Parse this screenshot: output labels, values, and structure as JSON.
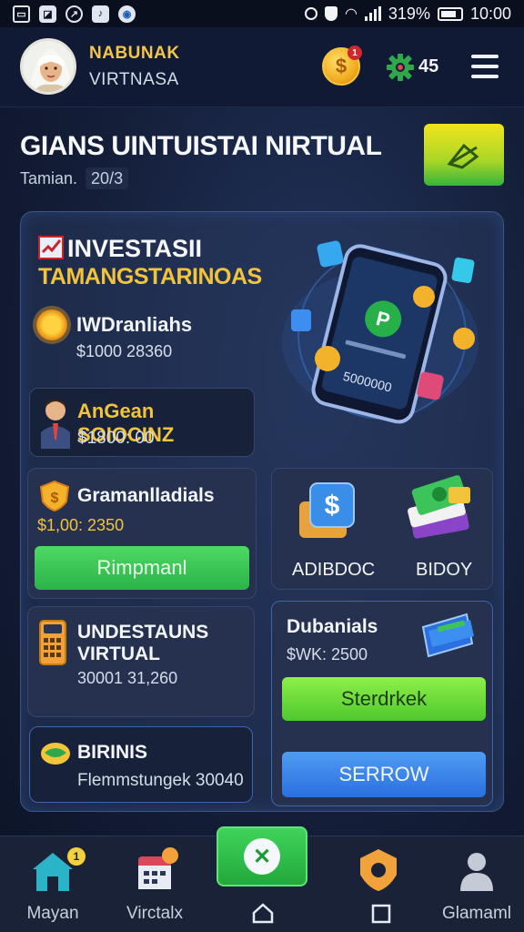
{
  "status_bar": {
    "battery_text": "319%",
    "time": "10:00"
  },
  "header": {
    "user_name": "NABUNAK",
    "user_subtitle": "VIRTNASA",
    "coin_badge": "1",
    "gear_count": "45"
  },
  "title_section": {
    "title": "GIANS UINTUISTAI NIRTUAL",
    "subtitle_prefix": "Tamian.",
    "subtitle_value": "20/3"
  },
  "investment_panel": {
    "title": "INVESTASII",
    "subtitle": "TAMANGSTARINOAS",
    "row_a": {
      "label": "IWDranliahs",
      "value": "$1000 28360"
    },
    "phone_screen_text": "5000000",
    "profile_card": {
      "label": "AnGean SOIOCINZ",
      "value": "$1800: 00"
    }
  },
  "cards": {
    "gramanlad": {
      "title": "Gramanlladials",
      "value": "$1,00: 2350",
      "button": "Rimpmanl"
    },
    "icons_card": {
      "left_label": "ADIBDOC",
      "right_label": "BIDOY"
    },
    "undestauns": {
      "title_line1": "UNDESTAUNS",
      "title_line2": "VIRTUAL",
      "value": "30001 31,260"
    },
    "dubanials": {
      "title": "Dubanials",
      "value": "$WK: 2500",
      "button1": "Sterdrkek",
      "button2": "SERROW"
    },
    "birinis": {
      "title": "BIRINIS",
      "value": "Flemmstungek 30040"
    }
  },
  "bottom_nav": {
    "items": [
      {
        "label": "Mayan",
        "badge": "1"
      },
      {
        "label": "Virctalx",
        "badge": ""
      },
      {
        "label": ""
      },
      {
        "label": ""
      },
      {
        "label": "Glamaml"
      }
    ]
  },
  "colors": {
    "accent_gold": "#f2c43a",
    "green_button": "#2bb348",
    "lime_button": "#4ec82e",
    "blue_button": "#2b6fe0",
    "panel_bg": "#28385c"
  }
}
